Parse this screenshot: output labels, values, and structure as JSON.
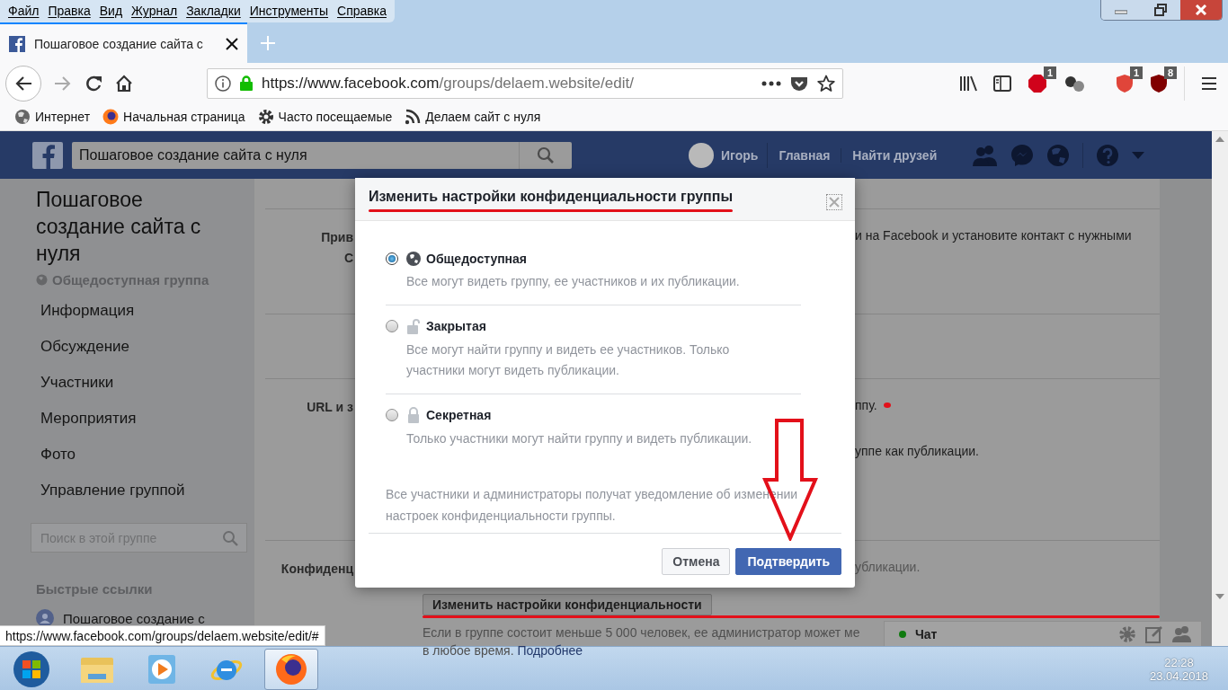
{
  "menu_bar": [
    "Файл",
    "Правка",
    "Вид",
    "Журнал",
    "Закладки",
    "Инструменты",
    "Справка"
  ],
  "tabs": [
    {
      "title": "Пошаговое создание сайта с",
      "selected": true
    }
  ],
  "address_bar": {
    "url_host": "https://www.facebook.com",
    "url_path": "/groups/delaem.website/edit/"
  },
  "extensions": [
    {
      "kind": "adblock",
      "badge": "1"
    },
    {
      "kind": "spheres"
    },
    {
      "kind": "shield",
      "badge": "1"
    },
    {
      "kind": "ublock",
      "badge": "8"
    }
  ],
  "bookmarks": [
    {
      "kind": "globe",
      "label": "Интернет"
    },
    {
      "kind": "firefox",
      "label": "Начальная страница"
    },
    {
      "kind": "gear",
      "label": "Часто посещаемые"
    },
    {
      "kind": "rss",
      "label": "Делаем сайт с нуля"
    }
  ],
  "fb_header": {
    "search_value": "Пошаговое создание сайта с нуля",
    "user": "Игорь",
    "links": [
      "Главная",
      "Найти друзей"
    ]
  },
  "sidebar": {
    "group_title": "Пошаговое создание сайта с нуля",
    "privacy": "Общедоступная группа",
    "items": [
      "Информация",
      "Обсуждение",
      "Участники",
      "Мероприятия",
      "Фото",
      "Управление группой"
    ],
    "search_placeholder": "Поиск в этой группе",
    "quick_links_title": "Быстрые ссылки",
    "quick_links": [
      "Пошаговое создание с"
    ]
  },
  "settings_sections": [
    {
      "label_lines": [
        "Прив",
        "С"
      ],
      "texts": [
        "и на Facebook и установите контакт с нужными"
      ]
    },
    {
      "label_lines": [
        "URL и з"
      ],
      "texts": [
        "ппу.",
        "уппе как публикации."
      ]
    },
    {
      "label_lines": [
        "Конфиденц"
      ],
      "texts": [
        "убликации."
      ],
      "button": "Изменить настройки конфиденциальности",
      "note": "Если в группе состоит меньше 5 000 человек, ее администратор может ме",
      "note_end": "в любое время.",
      "link": "Подробнее"
    }
  ],
  "dialog": {
    "title": "Изменить настройки конфиденциальности группы",
    "options": [
      {
        "kind": "public",
        "label": "Общедоступная",
        "description": "Все могут видеть группу, ее участников и их публикации.",
        "selected": true
      },
      {
        "kind": "closed",
        "label": "Закрытая",
        "description": "Все могут найти группу и видеть ее участников. Только участники могут видеть публикации.",
        "selected": false
      },
      {
        "kind": "secret",
        "label": "Секретная",
        "description": "Только участники могут найти группу и видеть публикации.",
        "selected": false
      }
    ],
    "note": "Все участники и администраторы получат уведомление об изменении настроек конфиденциальности группы.",
    "cancel": "Отмена",
    "confirm": "Подтвердить"
  },
  "status_tooltip": "https://www.facebook.com/groups/delaem.website/edit/#",
  "chat": {
    "label": "Чат",
    "online": true
  },
  "taskbar": {
    "apps": [
      {
        "kind": "explorer",
        "active": false
      },
      {
        "kind": "media",
        "active": false
      },
      {
        "kind": "ie",
        "active": false
      },
      {
        "kind": "firefox",
        "active": true
      }
    ],
    "time": "22:28",
    "date": "23.04.2018"
  }
}
